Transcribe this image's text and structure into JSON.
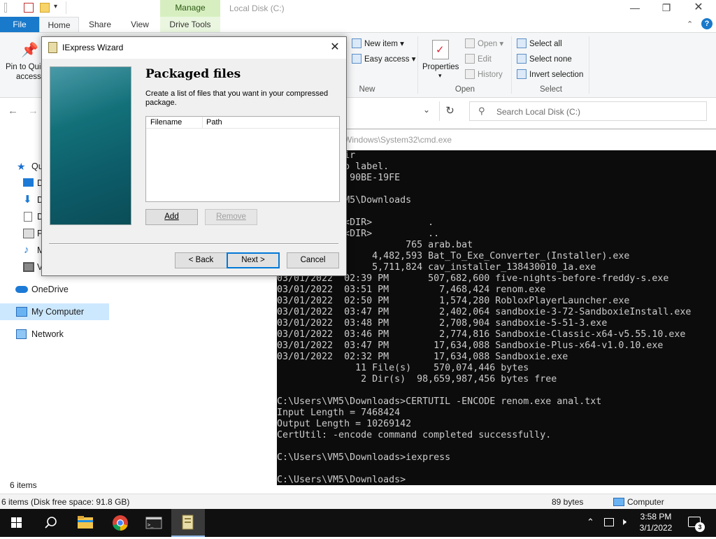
{
  "explorer": {
    "window_title": "Local Disk (C:)",
    "tabs": {
      "file": "File",
      "home": "Home",
      "share": "Share",
      "view": "View",
      "manage": "Manage",
      "drive_tools": "Drive Tools"
    },
    "ribbon": {
      "pin_to_quick_access": "Pin to Qui",
      "pin_to_quick_access_2": "access",
      "new_item": "New item",
      "easy_access": "Easy access",
      "new_group": "New",
      "properties": "Properties",
      "open": "Open",
      "edit": "Edit",
      "history": "History",
      "open_group": "Open",
      "select_all": "Select all",
      "select_none": "Select none",
      "invert_selection": "Invert selection",
      "select_group": "Select"
    },
    "search": {
      "placeholder": "Search Local Disk (C:)"
    },
    "nav": {
      "quick_access": "Qu",
      "item_d1": "D",
      "item_d2": "D",
      "item_d3": "D",
      "item_p": "P",
      "item_m": "M",
      "item_v": "V",
      "onedrive": "OneDrive",
      "my_computer": "My Computer",
      "network": "Network"
    },
    "status": {
      "items": "6 items",
      "detail": "6 items (Disk free space: 91.8 GB)",
      "size": "89 bytes",
      "location": "Computer"
    }
  },
  "cmd": {
    "title": "r: C:\\Windows\\System32\\cmd.exe",
    "output": "\\Downloads>dir\nrive C has no label.\nal Number is 90BE-19FE\n\nf C:\\Users\\VM5\\Downloads\n\n03:54 PM    <DIR>          .\n03:54 PM    <DIR>          ..\n03:54 PM               765 arab.bat\n03:53 PM         4,482,593 Bat_To_Exe_Converter_(Installer).exe\n03:49 PM         5,711,824 cav_installer_138430010_1a.exe\n03/01/2022  02:39 PM       507,682,600 five-nights-before-freddy-s.exe\n03/01/2022  03:51 PM         7,468,424 renom.exe\n03/01/2022  02:50 PM         1,574,280 RobloxPlayerLauncher.exe\n03/01/2022  03:47 PM         2,402,064 sandboxie-3-72-SandboxieInstall.exe\n03/01/2022  03:48 PM         2,708,904 sandboxie-5-51-3.exe\n03/01/2022  03:46 PM         2,774,816 Sandboxie-Classic-x64-v5.55.10.exe\n03/01/2022  03:47 PM        17,634,088 Sandboxie-Plus-x64-v1.0.10.exe\n03/01/2022  02:32 PM        17,634,088 Sandboxie.exe\n              11 File(s)    570,074,446 bytes\n               2 Dir(s)  98,659,987,456 bytes free\n\nC:\\Users\\VM5\\Downloads>CERTUTIL -ENCODE renom.exe anal.txt\nInput Length = 7468424\nOutput Length = 10269142\nCertUtil: -encode command completed successfully.\n\nC:\\Users\\VM5\\Downloads>iexpress\n\nC:\\Users\\VM5\\Downloads>"
  },
  "wizard": {
    "title": "IExpress Wizard",
    "heading": "Packaged files",
    "description": "Create a list of files that you want in your compressed package.",
    "columns": [
      "Filename",
      "Path"
    ],
    "buttons": {
      "add": "Add",
      "remove": "Remove",
      "back": "< Back",
      "next": "Next >",
      "cancel": "Cancel"
    }
  },
  "taskbar": {
    "time": "3:58 PM",
    "date": "3/1/2022",
    "notification_count": "3"
  },
  "colors": {
    "file_tab": "#1979ca",
    "manage_tab": "#d7efc0",
    "cmd_bg": "#0c0c0c",
    "selection": "#cce8ff",
    "taskbar": "#101010"
  }
}
